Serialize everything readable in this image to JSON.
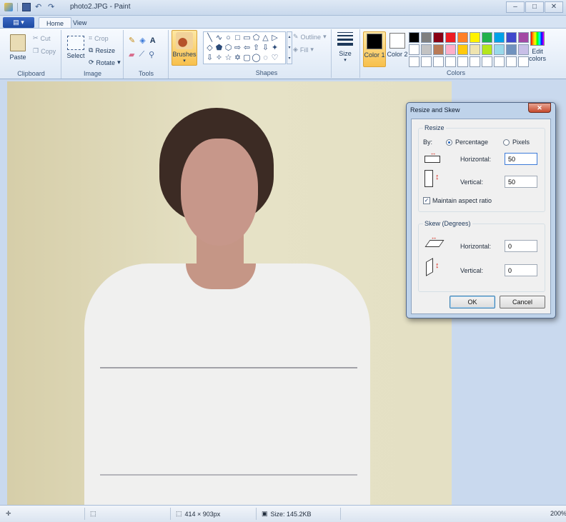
{
  "window": {
    "title": "photo2.JPG - Paint",
    "controls": {
      "minimize": "–",
      "maximize": "□",
      "close": "✕"
    }
  },
  "ribbon": {
    "paint_menu": "▤ ▾",
    "tabs": [
      {
        "label": "Home",
        "active": true
      },
      {
        "label": "View",
        "active": false
      }
    ],
    "clipboard": {
      "label": "Clipboard",
      "paste": "Paste",
      "cut": "Cut",
      "copy": "Copy"
    },
    "image": {
      "label": "Image",
      "select": "Select",
      "crop": "Crop",
      "resize": "Resize",
      "rotate": "Rotate"
    },
    "tools": {
      "label": "Tools"
    },
    "brushes": {
      "label": "Brushes"
    },
    "shapes": {
      "label": "Shapes",
      "outline": "Outline",
      "fill": "Fill",
      "glyphs": [
        "╲",
        "∿",
        "○",
        "□",
        "▭",
        "⬠",
        "△",
        "▷",
        "◇",
        "⬟",
        "⬡",
        "⇨",
        "⇦",
        "⇧",
        "⇩",
        "✦",
        "⇩",
        "✧",
        "☆",
        "✡",
        "▢",
        "◯",
        "◌",
        "♡"
      ]
    },
    "size": {
      "label": "Size"
    },
    "colors": {
      "label": "Colors",
      "color1": "Color 1",
      "color2": "Color 2",
      "color1_value": "#000000",
      "color2_value": "#ffffff",
      "edit_colors": "Edit colors",
      "palette": [
        "#000000",
        "#7f7f7f",
        "#880015",
        "#ed1c24",
        "#ff7f27",
        "#fff200",
        "#22b14c",
        "#00a2e8",
        "#3f48cc",
        "#a349a4",
        "#ffffff",
        "#c3c3c3",
        "#b97a57",
        "#ffaec9",
        "#ffc90e",
        "#efe4b0",
        "#b5e61d",
        "#99d9ea",
        "#7092be",
        "#c8bfe7",
        "#ffffff",
        "#ffffff",
        "#ffffff",
        "#ffffff",
        "#ffffff",
        "#ffffff",
        "#ffffff",
        "#ffffff",
        "#ffffff",
        "#ffffff"
      ]
    }
  },
  "dialog": {
    "title": "Resize and Skew",
    "resize": {
      "legend": "Resize",
      "by_label": "By:",
      "percentage_label": "Percentage",
      "pixels_label": "Pixels",
      "horizontal_label": "Horizontal:",
      "horizontal_value": "50",
      "vertical_label": "Vertical:",
      "vertical_value": "50",
      "maintain_aspect_label": "Maintain aspect ratio"
    },
    "skew": {
      "legend": "Skew (Degrees)",
      "horizontal_label": "Horizontal:",
      "horizontal_value": "0",
      "vertical_label": "Vertical:",
      "vertical_value": "0"
    },
    "ok_label": "OK",
    "cancel_label": "Cancel"
  },
  "statusbar": {
    "dimensions": "414 × 903px",
    "size": "Size: 145.2KB",
    "zoom": "200%"
  }
}
